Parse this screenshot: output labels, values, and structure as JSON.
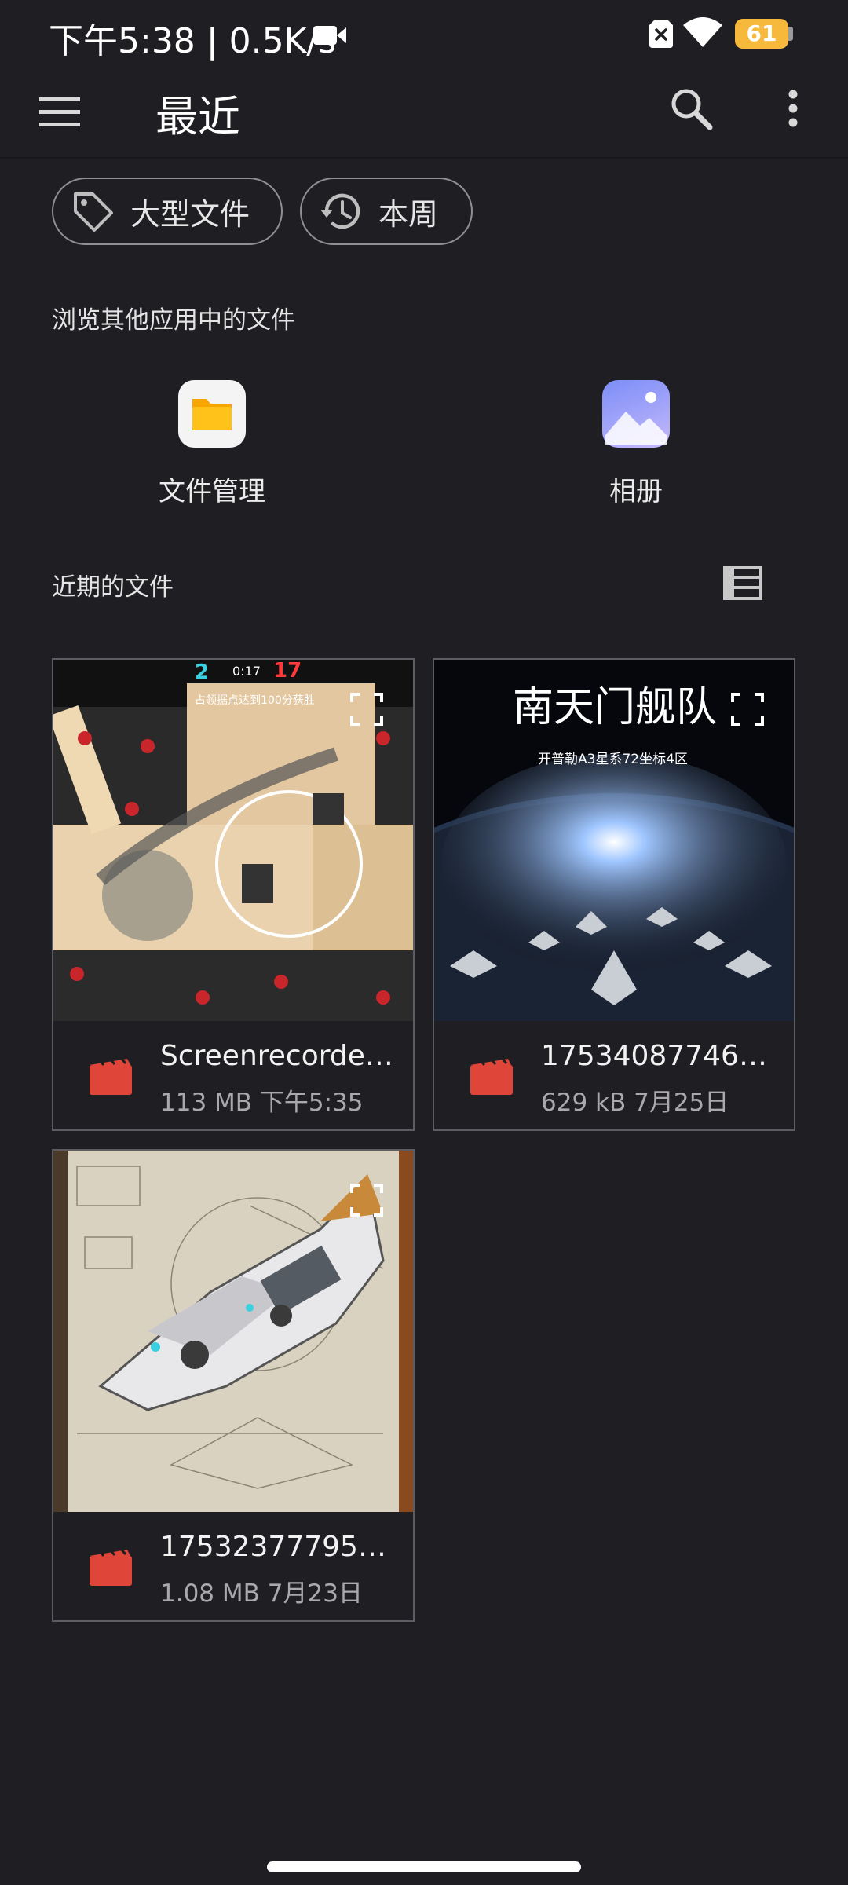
{
  "status_bar": {
    "time_speed": "下午5:38 | 0.5K/s",
    "battery": "61"
  },
  "app_bar": {
    "title": "最近"
  },
  "chips": [
    {
      "label": "大型文件",
      "icon": "tag-icon"
    },
    {
      "label": "本周",
      "icon": "history-icon"
    }
  ],
  "browse": {
    "label": "浏览其他应用中的文件",
    "apps": [
      {
        "label": "文件管理",
        "icon": "folder-app-icon"
      },
      {
        "label": "相册",
        "icon": "gallery-app-icon"
      }
    ]
  },
  "recent": {
    "label": "近期的文件",
    "files": [
      {
        "name": "Screenrecorder...",
        "size": "113 MB",
        "date": "下午5:35",
        "thumb_text": {
          "score_left": "2",
          "time": "0:17",
          "score_right": "17",
          "caption": "占领据点达到100分获胜"
        }
      },
      {
        "name": "175340877466...",
        "size": "629 kB",
        "date": "7月25日",
        "thumb_text": {
          "title": "南天门舰队",
          "subtitle": "开普勒A3星系72坐标4区"
        }
      },
      {
        "name": "175323777957...",
        "size": "1.08 MB",
        "date": "7月23日"
      }
    ]
  },
  "colors": {
    "background": "#1f1f23",
    "video_icon": "#e0453a",
    "battery": "#f6b93b"
  }
}
